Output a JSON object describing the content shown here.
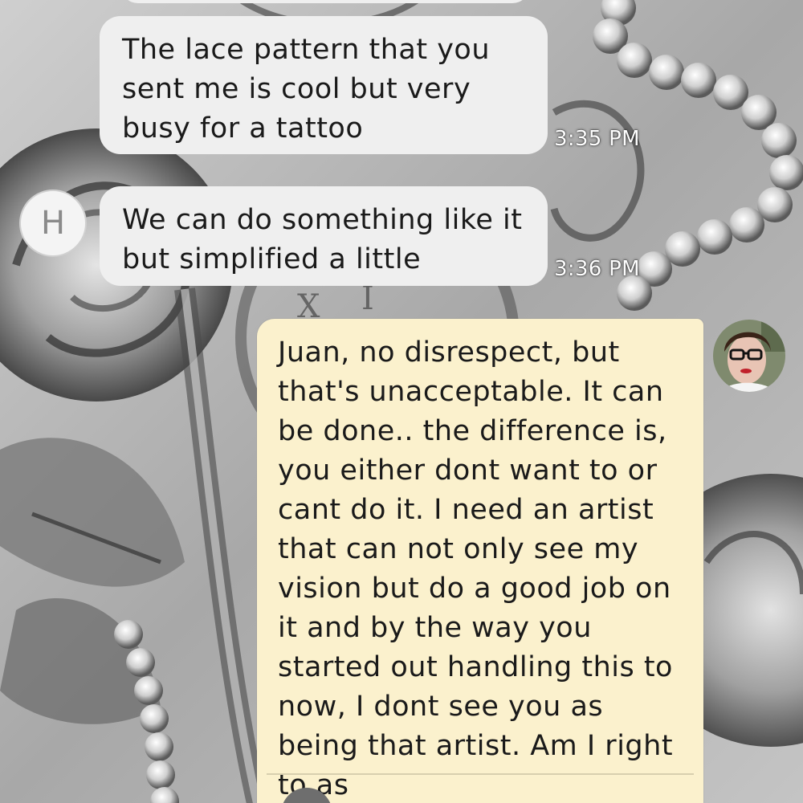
{
  "conversation": {
    "messages": [
      {
        "sender": "H",
        "direction": "incoming",
        "text": "The lace pattern that you sent me is cool but very busy for a tattoo",
        "time": "3:35 PM"
      },
      {
        "sender": "H",
        "direction": "incoming",
        "text": "We can do something like it but simplified a little",
        "time": "3:36 PM"
      },
      {
        "sender": "me",
        "direction": "outgoing",
        "text": "Juan, no disrespect, but that's unacceptable. It can be done.. the difference is, you either dont want to or cant do it. I need an artist that can not only see my vision but do a good job on it and by the way you started out handling this to now, I dont see you as being that artist. Am I right to as"
      }
    ]
  },
  "avatars": {
    "contact_initial": "H"
  },
  "icons": {
    "outgoing_expand": "chevron-down-icon",
    "contact_avatar": "letter-avatar-icon",
    "user_avatar": "profile-photo-icon"
  },
  "colors": {
    "incoming_bubble": "#efefef",
    "outgoing_bubble": "#fbf1cd",
    "timestamp_text": "#ffffff"
  }
}
